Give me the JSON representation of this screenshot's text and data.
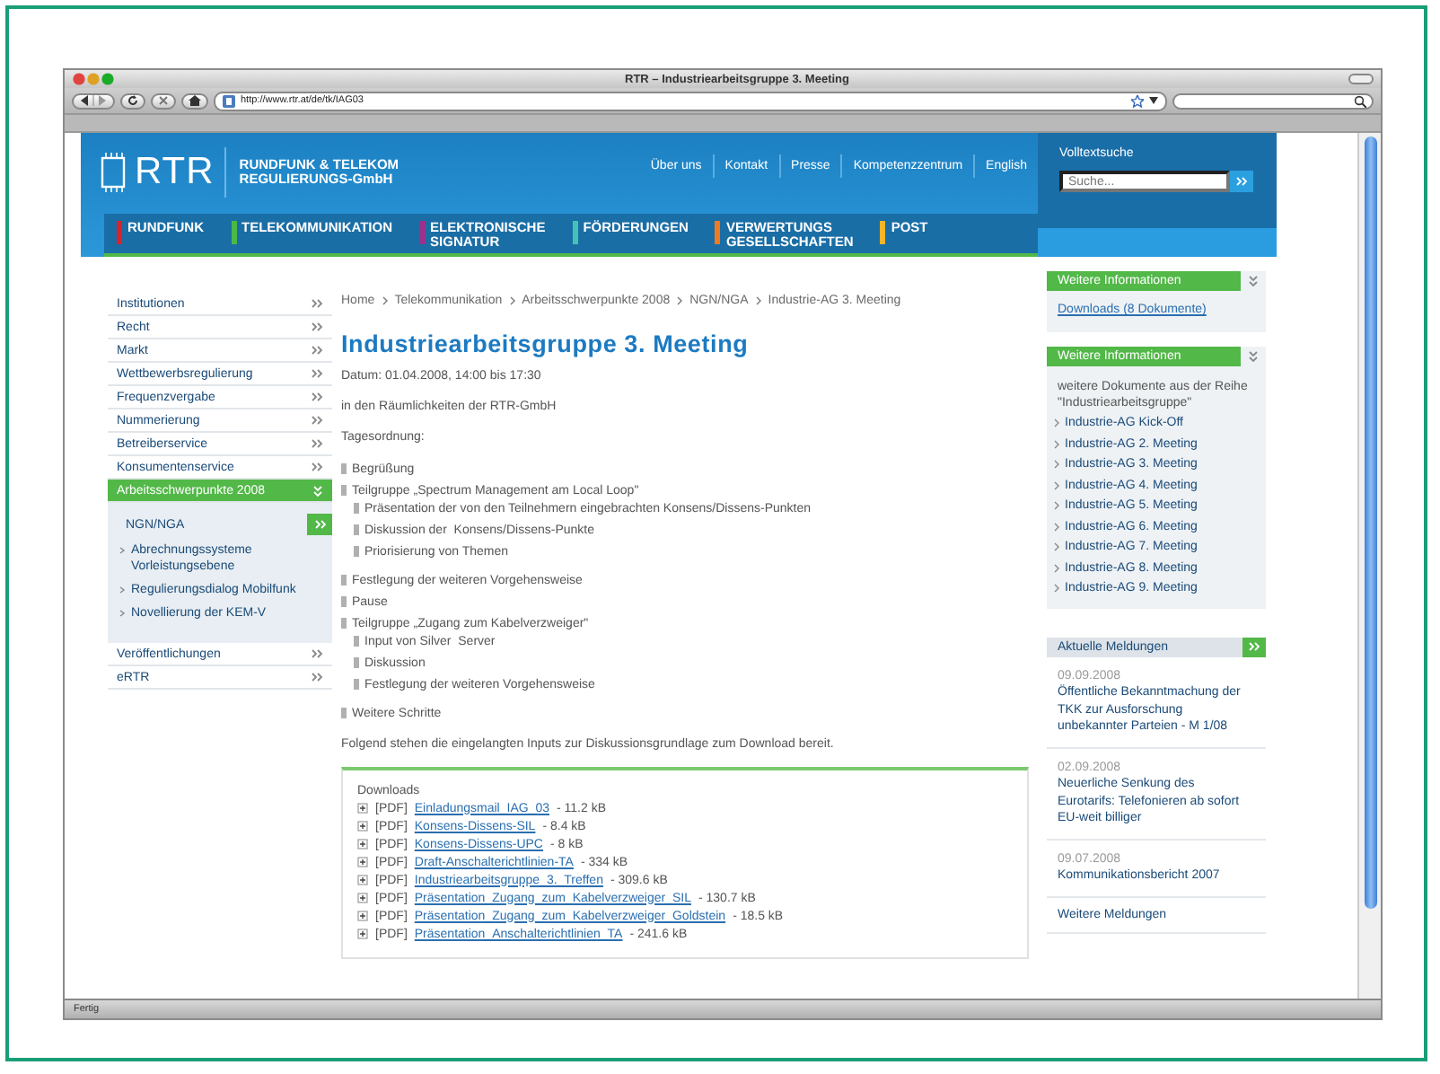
{
  "browser": {
    "title": "RTR – Industriearbeitsgruppe 3. Meeting",
    "url": "http://www.rtr.at/de/tk/IAG03",
    "status": "Fertig"
  },
  "header": {
    "logo": "RTR",
    "org_name": [
      "RUNDFUNK & TELEKOM",
      "REGULIERUNGS-GmbH"
    ],
    "top_links": [
      "Über uns",
      "Kontakt",
      "Presse",
      "Kompetenzzentrum",
      "English"
    ],
    "search": {
      "label": "Volltextsuche",
      "placeholder": "Suche..."
    },
    "main_nav": [
      {
        "label": "RUNDFUNK",
        "color": "#d8232a"
      },
      {
        "label": "TELEKOMMUNIKATION",
        "color": "#4cb848"
      },
      {
        "label": "ELEKTRONISCHE\nSIGNATUR",
        "color": "#a0308c"
      },
      {
        "label": "FÖRDERUNGEN",
        "color": "#46c2b4"
      },
      {
        "label": "VERWERTUNGS\nGESELLSCHAFTEN",
        "color": "#f07a22"
      },
      {
        "label": "POST",
        "color": "#f4b52a"
      }
    ]
  },
  "left_nav": [
    {
      "label": "Institutionen",
      "selected": false,
      "expanded": false
    },
    {
      "label": "Recht",
      "selected": false,
      "expanded": false
    },
    {
      "label": "Markt",
      "selected": false,
      "expanded": false
    },
    {
      "label": "Wettbewerbsregulierung",
      "selected": false,
      "expanded": false
    },
    {
      "label": "Frequenzvergabe",
      "selected": false,
      "expanded": false
    },
    {
      "label": "Nummerierung",
      "selected": false,
      "expanded": false
    },
    {
      "label": "Betreiberservice",
      "selected": false,
      "expanded": false
    },
    {
      "label": "Konsumentenservice",
      "selected": false,
      "expanded": false
    },
    {
      "label": "Arbeitsschwerpunkte 2008",
      "selected": true,
      "expanded": true,
      "children": [
        {
          "label": "NGN/NGA",
          "selected": true
        },
        {
          "label": "Abrechnungssysteme Vorleistungsebene",
          "selected": false
        },
        {
          "label": "Regulierungsdialog Mobilfunk",
          "selected": false
        },
        {
          "label": "Novellierung der KEM-V",
          "selected": false
        }
      ]
    },
    {
      "label": "Veröffentlichungen",
      "selected": false,
      "expanded": false
    },
    {
      "label": "eRTR",
      "selected": false,
      "expanded": false
    }
  ],
  "content": {
    "breadcrumb": [
      "Home",
      "Telekommunikation",
      "Arbeitsschwerpunkte 2008",
      "NGN/NGA",
      "Industrie-AG 3. Meeting"
    ],
    "title": "Industriearbeitsgruppe 3. Meeting",
    "date": "Datum: 01.04.2008, 14:00 bis 17:30",
    "place": "in den Räumlichkeiten der RTR-GmbH",
    "agenda_label": "Tagesordnung:",
    "agenda": [
      {
        "text": "Begrüßung"
      },
      {
        "text": "Teilgruppe „Spectrum Management am Local Loop\"",
        "children": [
          {
            "text": "Präsentation der von den Teilnehmern eingebrachten Konsens/Dissens-Punkten"
          },
          {
            "text": "Diskussion der  Konsens/Dissens-Punkte"
          },
          {
            "text": "Priorisierung von Themen"
          }
        ]
      },
      {
        "text": "Festlegung der weiteren Vorgehensweise"
      },
      {
        "text": "Pause"
      },
      {
        "text": "Teilgruppe „Zugang zum Kabelverzweiger\"",
        "children": [
          {
            "text": "Input von Silver  Server"
          },
          {
            "text": "Diskussion"
          },
          {
            "text": "Festlegung der weiteren Vorgehensweise"
          }
        ]
      },
      {
        "text": "Weitere Schritte"
      }
    ],
    "intro": "Folgend stehen die eingelangten Inputs zur Diskussionsgrundlage zum Download bereit.",
    "downloads": {
      "title": "Downloads",
      "items": [
        {
          "type": "[PDF]",
          "name": "Einladungsmail_IAG_03",
          "size": "- 11.2 kB"
        },
        {
          "type": "[PDF]",
          "name": "Konsens-Dissens-SIL",
          "size": "- 8.4 kB"
        },
        {
          "type": "[PDF]",
          "name": "Konsens-Dissens-UPC",
          "size": "- 8 kB"
        },
        {
          "type": "[PDF]",
          "name": "Draft-Anschalterichtlinien-TA",
          "size": "- 334 kB"
        },
        {
          "type": "[PDF]",
          "name": "Industriearbeitsgruppe_3._Treffen",
          "size": "- 309.6 kB"
        },
        {
          "type": "[PDF]",
          "name": "Präsentation_Zugang_zum_Kabelverzweiger_SIL",
          "size": "- 130.7 kB"
        },
        {
          "type": "[PDF]",
          "name": "Präsentation_Zugang_zum_Kabelverzweiger_Goldstein",
          "size": "- 18.5 kB"
        },
        {
          "type": "[PDF]",
          "name": "Präsentation_Anschalterichtlinien_TA",
          "size": "- 241.6 kB"
        }
      ]
    }
  },
  "right": {
    "info_box": {
      "title": "Weitere Informationen",
      "link": "Downloads (8 Dokumente)"
    },
    "series_box": {
      "title": "Weitere Informationen",
      "intro": "weitere Dokumente aus der Reihe \"Industriearbeitsgruppe\"",
      "items": [
        "Industrie-AG Kick-Off",
        "Industrie-AG 2. Meeting",
        "Industrie-AG 3. Meeting",
        "Industrie-AG 4. Meeting",
        "Industrie-AG 5. Meeting",
        "Industrie-AG 6. Meeting",
        "Industrie-AG 7. Meeting",
        "Industrie-AG 8. Meeting",
        "Industrie-AG 9. Meeting"
      ]
    },
    "news": {
      "title": "Aktuelle Meldungen",
      "items": [
        {
          "date": "09.09.2008",
          "headline": "Öffentliche Bekanntmachung der TKK zur Ausforschung unbekannter Parteien - M 1/08"
        },
        {
          "date": "02.09.2008",
          "headline": "Neuerliche Senkung des Eurotarifs: Telefonieren ab sofort EU-weit billiger"
        },
        {
          "date": "09.07.2008",
          "headline": "Kommunikationsbericht 2007"
        }
      ],
      "more": "Weitere Meldungen"
    }
  }
}
